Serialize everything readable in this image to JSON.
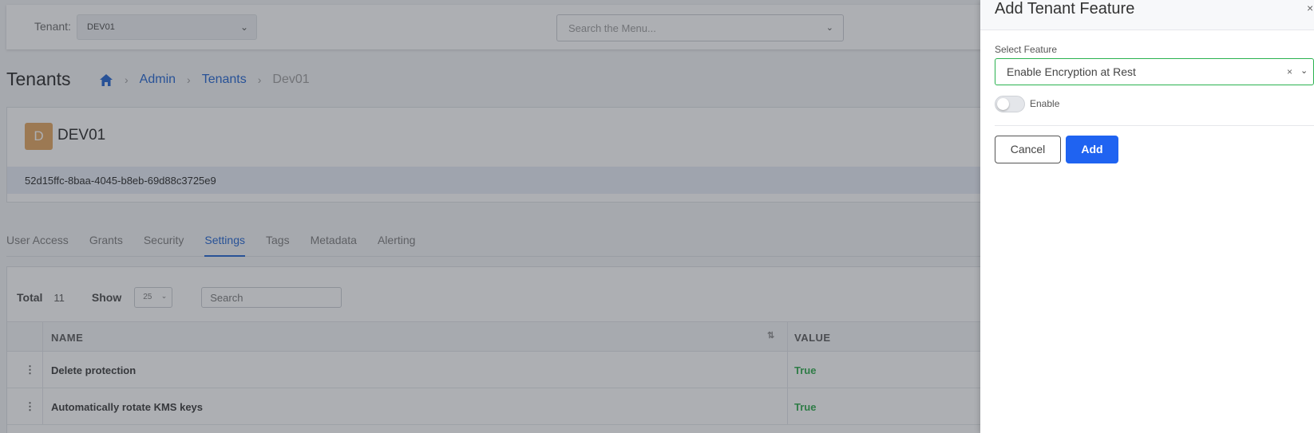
{
  "topbar": {
    "tenant_label": "Tenant:",
    "tenant_value": "DEV01",
    "menu_search_placeholder": "Search the Menu..."
  },
  "page": {
    "title": "Tenants",
    "breadcrumb": [
      "Admin",
      "Tenants",
      "Dev01"
    ]
  },
  "tenant_card": {
    "avatar_letter": "D",
    "name": "DEV01",
    "id": "52d15ffc-8baa-4045-b8eb-69d88c3725e9"
  },
  "tabs": [
    "User Access",
    "Grants",
    "Security",
    "Settings",
    "Tags",
    "Metadata",
    "Alerting"
  ],
  "active_tab": "Settings",
  "table": {
    "total_label": "Total",
    "total_count": "11",
    "show_label": "Show",
    "page_size": "25",
    "search_placeholder": "Search",
    "headers": {
      "name": "NAME",
      "value": "VALUE"
    },
    "rows": [
      {
        "name": "Delete protection",
        "value": "True"
      },
      {
        "name": "Automatically rotate KMS keys",
        "value": "True"
      }
    ]
  },
  "panel": {
    "title": "Add Tenant Feature",
    "close": "×",
    "select_label": "Select Feature",
    "selected_feature": "Enable Encryption at Rest",
    "clear": "×",
    "toggle_label": "Enable",
    "toggle_on": false,
    "cancel_label": "Cancel",
    "add_label": "Add"
  },
  "colors": {
    "accent": "#1a5fcf",
    "primary_button": "#1f63f1",
    "true_value": "#27a745",
    "select_border": "#2ab24f",
    "avatar": "#e2a35a"
  }
}
